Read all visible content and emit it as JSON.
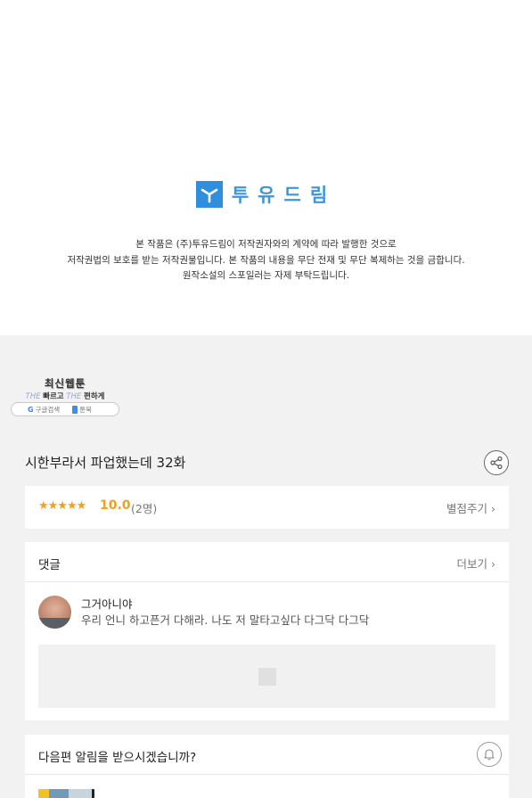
{
  "brand": {
    "name": "투유드림",
    "color": "#2f8fdc"
  },
  "notice": {
    "line1": "본 작품은 (주)투유드림이 저작권자와의 계약에 따라 발행한 것으로",
    "line2": "저작권법의 보호를 받는 저작권물입니다. 본 작품의 내용을 무단 전재 및 무단 복제하는 것을 금합니다.",
    "line3": "원작소설의 스포일러는 자제 부탁드립니다."
  },
  "promo": {
    "title": "최신웹툰",
    "sub_the1": "THE",
    "sub_fast": "빠르고",
    "sub_the2": "THE",
    "sub_easy": "편하게",
    "google_label": "구글검색",
    "book_label": "툰북"
  },
  "episode": {
    "title": "시한부라서 파업했는데 32화",
    "share_icon": "share-icon"
  },
  "rating": {
    "stars": "★★★★★",
    "score": "10.0",
    "count": "(2명)",
    "rate_label": "별점주기",
    "accent": "#f1a11e"
  },
  "comments": {
    "title": "댓글",
    "more_label": "더보기",
    "items": [
      {
        "author": "그거아니야",
        "text": "우리 언니 하고픈거 다해라. 나도 저 말타고싶다 다그닥 다그닥"
      }
    ]
  },
  "notify": {
    "title": "다음편 알림을 받으시겠습니까?",
    "bell_icon": "bell-icon"
  }
}
